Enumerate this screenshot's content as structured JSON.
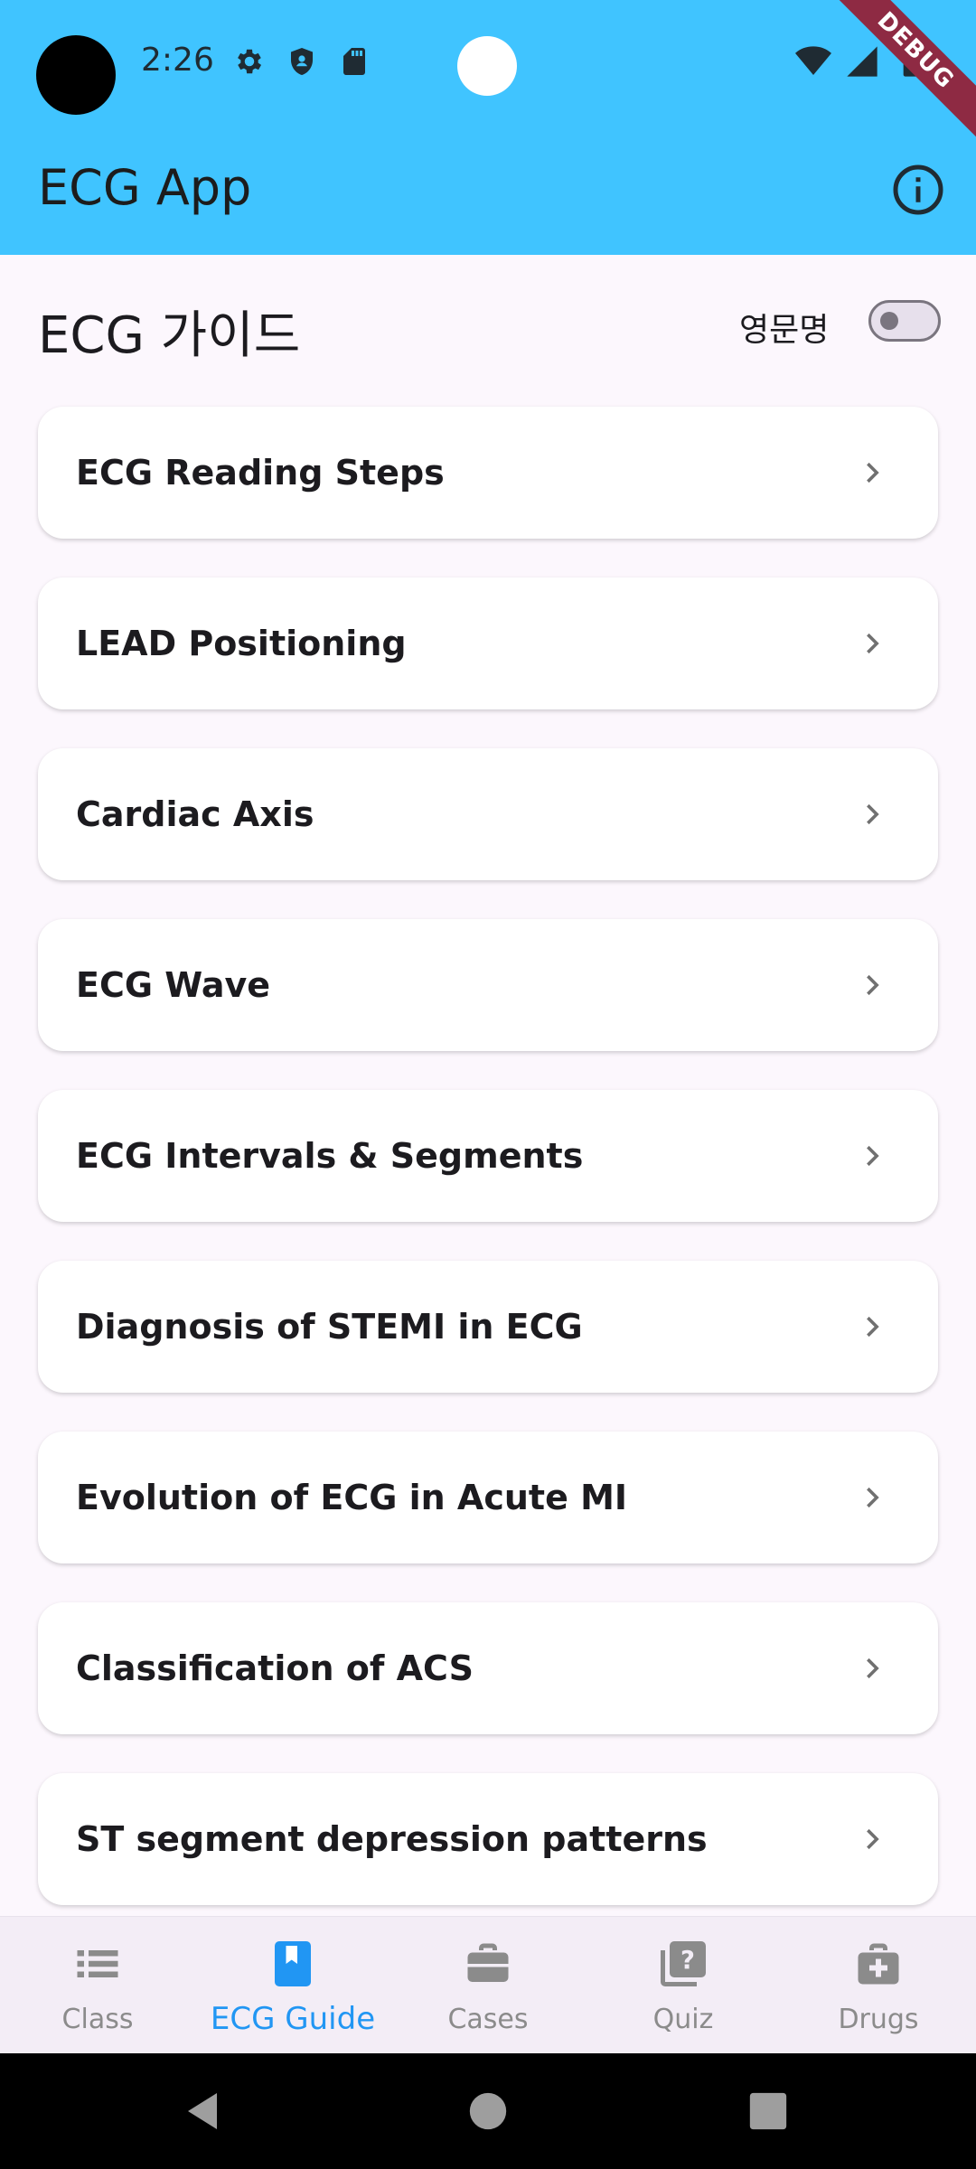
{
  "status_bar": {
    "time": "2:26",
    "icons": [
      "gear-icon",
      "shield-icon",
      "sd-card-icon"
    ],
    "right_icons": [
      "wifi-icon",
      "signal-icon",
      "battery-icon"
    ],
    "debug_banner": "DEBUG"
  },
  "app_bar": {
    "title": "ECG App",
    "action_icon": "info-icon"
  },
  "section": {
    "title": "ECG 가이드",
    "toggle_label": "영문명",
    "toggle_on": false
  },
  "guide_items": [
    {
      "title": "ECG Reading Steps"
    },
    {
      "title": "LEAD Positioning"
    },
    {
      "title": "Cardiac Axis"
    },
    {
      "title": "ECG Wave"
    },
    {
      "title": "ECG Intervals & Segments"
    },
    {
      "title": "Diagnosis of STEMI in ECG"
    },
    {
      "title": "Evolution of ECG in Acute MI"
    },
    {
      "title": "Classification of ACS"
    },
    {
      "title": "ST segment depression patterns"
    }
  ],
  "bottom_nav": {
    "items": [
      {
        "label": "Class",
        "icon": "list-icon",
        "active": false
      },
      {
        "label": "ECG Guide",
        "icon": "bookmark-book-icon",
        "active": true
      },
      {
        "label": "Cases",
        "icon": "briefcase-icon",
        "active": false
      },
      {
        "label": "Quiz",
        "icon": "quiz-icon",
        "active": false
      },
      {
        "label": "Drugs",
        "icon": "medical-kit-icon",
        "active": false
      }
    ]
  },
  "colors": {
    "app_bar": "#40c4ff",
    "background": "#fcf7fd",
    "active_nav": "#2196f3",
    "inactive_nav": "#8b8b8b"
  }
}
